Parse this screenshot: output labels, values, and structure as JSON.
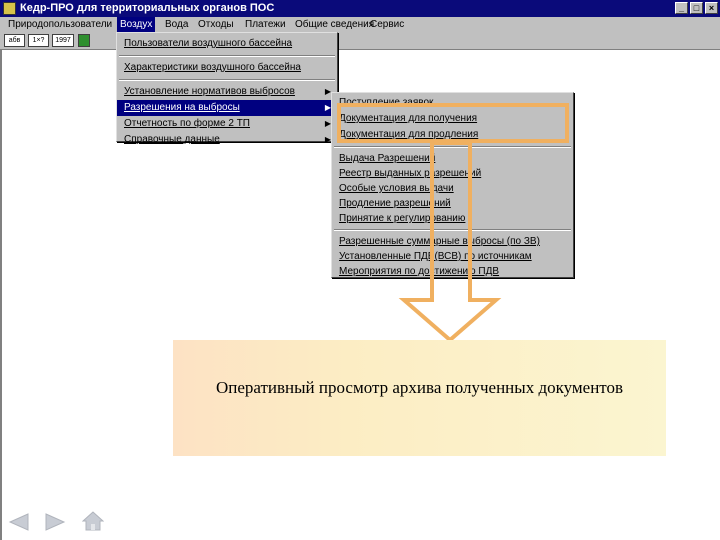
{
  "window": {
    "title": "Кедр-ПРО для территориальных органов ПОС"
  },
  "menubar": {
    "items": [
      {
        "label": "Природопользователи"
      },
      {
        "label": "Воздух"
      },
      {
        "label": "Вода"
      },
      {
        "label": "Отходы"
      },
      {
        "label": "Платежи"
      },
      {
        "label": "Общие сведения"
      },
      {
        "label": "Сервис"
      }
    ],
    "active_index": 1
  },
  "toolbar": {
    "buttons": [
      {
        "label": "абв"
      },
      {
        "label": "1×?"
      },
      {
        "label": "1997"
      }
    ]
  },
  "air_menu": {
    "items": [
      {
        "label": "Пользователи воздушного бассейна"
      },
      {
        "label": "Характеристики воздушного бассейна"
      },
      {
        "label": "Установление нормативов выбросов"
      },
      {
        "label": "Разрешения на выбросы"
      },
      {
        "label": "Отчетность по форме 2 ТП"
      },
      {
        "label": "Справочные данные"
      }
    ],
    "highlighted_index": 3
  },
  "permits_submenu": {
    "items": [
      {
        "label": "Поступление заявок"
      },
      {
        "label": "Документация для получения"
      },
      {
        "label": "Документация для продления"
      },
      {
        "label": "Выдача Разрешений"
      },
      {
        "label": "Реестр выданных разрешений"
      },
      {
        "label": "Особые условия выдачи"
      },
      {
        "label": "Продление разрешений"
      },
      {
        "label": "Принятие к регулированию"
      },
      {
        "label": "Разрешенные суммарные выбросы (по ЗВ)"
      },
      {
        "label": "Установленные ПДВ(ВСВ) по источникам"
      },
      {
        "label": "Мероприятия по достижению ПДВ"
      }
    ]
  },
  "callout": {
    "text": "Оперативный просмотр архива полученных документов"
  },
  "colors": {
    "titlebar": "#0a0a7a",
    "highlight": "#000080",
    "orange": "#f0b060",
    "callout_bg": "#fcedc4"
  },
  "icons": [
    "app-icon",
    "prev-arrow-icon",
    "next-arrow-icon",
    "home-icon"
  ]
}
